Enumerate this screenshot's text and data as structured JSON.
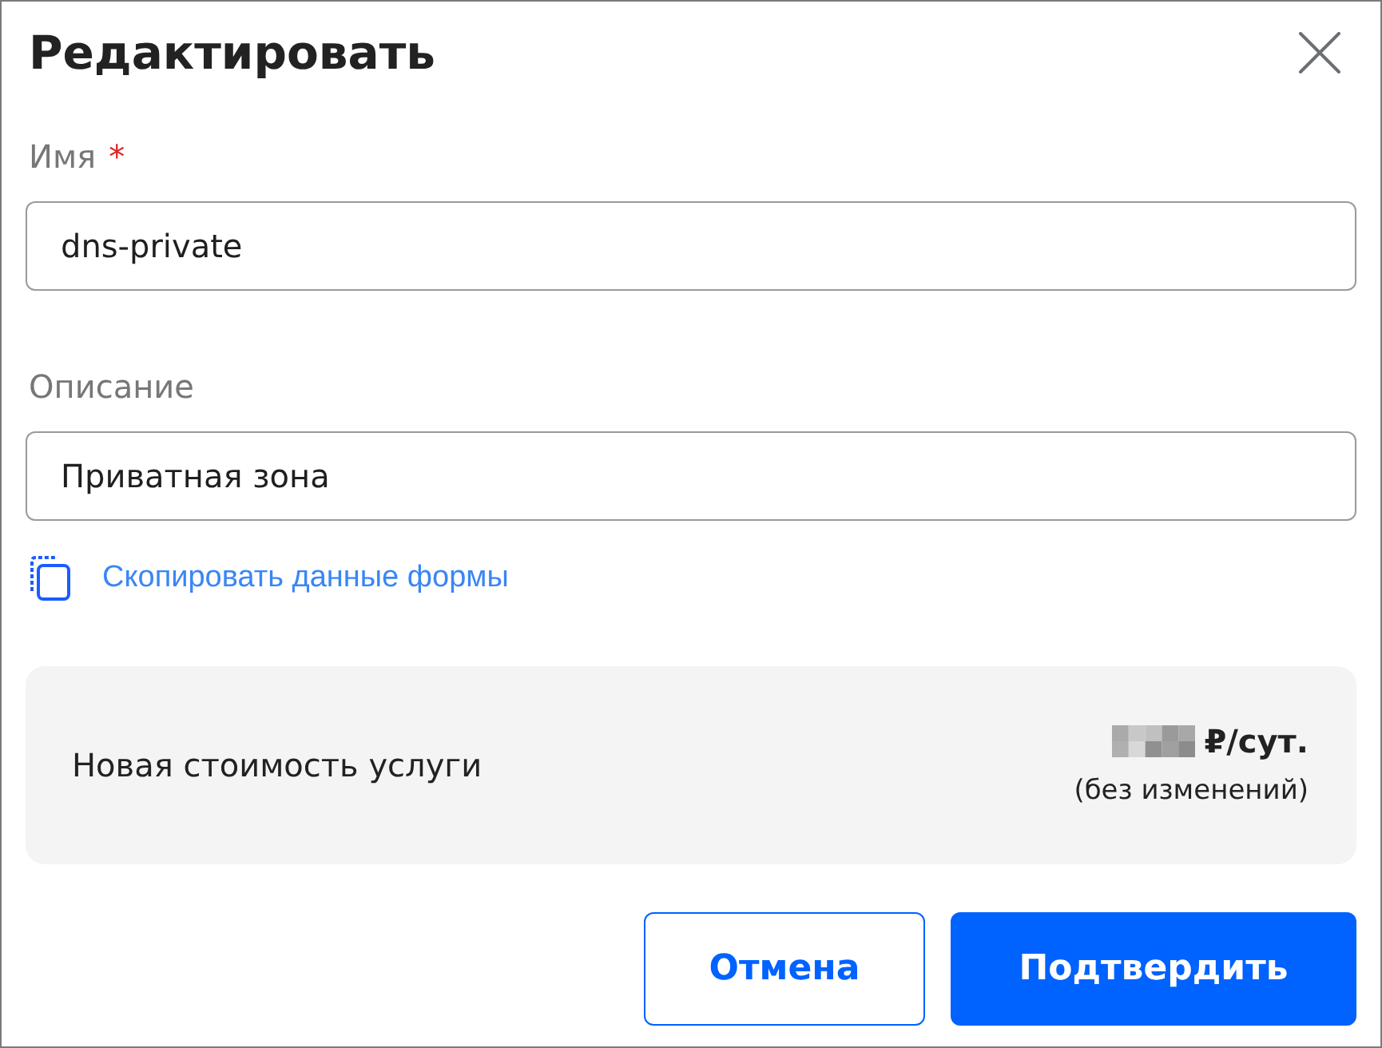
{
  "dialog": {
    "title": "Редактировать"
  },
  "fields": [
    {
      "label": "Имя",
      "required_mark": "*",
      "value": "dns-private"
    },
    {
      "label": "Описание",
      "value": "Приватная зона"
    }
  ],
  "copy_link": {
    "label": "Скопировать данные формы"
  },
  "price": {
    "label": "Новая стоимость услуги",
    "amount_hidden": true,
    "unit": "₽/сут.",
    "note": "(без изменений)"
  },
  "buttons": [
    {
      "label": "Отмена",
      "kind": "secondary"
    },
    {
      "label": "Подтвердить",
      "kind": "primary"
    }
  ]
}
